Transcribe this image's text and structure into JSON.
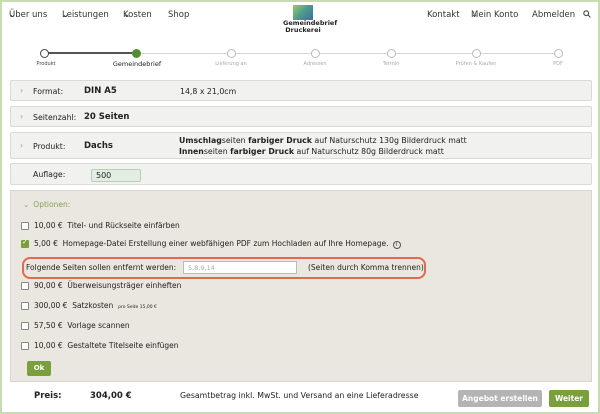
{
  "nav": {
    "left": [
      "Über uns",
      "Leistungen",
      "Kosten",
      "Shop"
    ],
    "right": [
      "Kontakt",
      "Mein Konto",
      "Abmelden"
    ],
    "logo_line1": "Gemeindebrief",
    "logo_line2": "Druckerei",
    "search_icon": "🔍"
  },
  "steps": [
    {
      "label": "Produkt",
      "state": "done"
    },
    {
      "label": "Gemeindebrief",
      "state": "current"
    },
    {
      "label": "Lieferung an",
      "state": "todo"
    },
    {
      "label": "Adressen",
      "state": "todo"
    },
    {
      "label": "Termin",
      "state": "todo"
    },
    {
      "label": "Prüfen & Kaufen",
      "state": "todo"
    },
    {
      "label": "PDF",
      "state": "todo"
    }
  ],
  "format": {
    "label": "Format:",
    "value": "DIN A5",
    "detail": "14,8 x 21,0cm"
  },
  "pages": {
    "label": "Seitenzahl:",
    "value": "20 Seiten"
  },
  "product": {
    "label": "Produkt:",
    "value": "Dachs",
    "line1_a": "Umschlag",
    "line1_b": "seiten ",
    "line1_c": "farbiger Druck",
    "line1_d": " auf Naturschutz 130g Bilderdruck matt",
    "line2_a": "Innen",
    "line2_b": "seiten ",
    "line2_c": "farbiger Druck",
    "line2_d": " auf Naturschutz 80g Bilderdruck matt"
  },
  "auflage": {
    "label": "Auflage:",
    "value": "500"
  },
  "options": {
    "title": "Optionen:",
    "items": [
      {
        "price": "10,00 €",
        "text": "Titel- und Rückseite einfärben",
        "checked": false
      },
      {
        "price": "5,00 €",
        "text": "Homepage-Datei  Erstellung einer webfähigen PDF zum Hochladen auf Ihre Homepage.",
        "checked": true
      },
      {
        "price": "90,00 €",
        "text": "Überweisungsträger einheften",
        "checked": false
      },
      {
        "price": "300,00 €",
        "text": "Satzkosten",
        "small": "pro Seite 15,00 €",
        "checked": false
      },
      {
        "price": "57,50 €",
        "text": "Vorlage scannen",
        "checked": false
      },
      {
        "price": "10,00 €",
        "text": "Gestaltete Titelseite einfügen",
        "checked": false
      }
    ],
    "remove_label": "Folgende Seiten sollen entfernt werden:",
    "remove_placeholder": "5,8,9,14",
    "remove_note": "(Seiten durch Komma trennen)",
    "ok": "Ok"
  },
  "footer": {
    "price_label": "Preis:",
    "price_value": "304,00 €",
    "note": "Gesamtbetrag inkl. MwSt. und Versand an eine Lieferadresse",
    "offer_button": "Angebot erstellen",
    "next_button": "Weiter"
  },
  "colors": {
    "accent": "#7aa03c",
    "highlight": "#e06a4e"
  }
}
